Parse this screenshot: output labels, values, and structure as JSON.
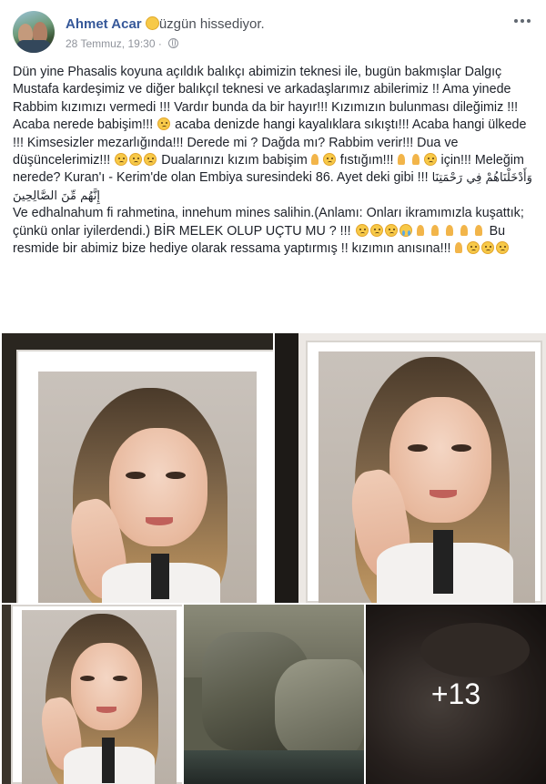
{
  "post": {
    "author": "Ahmet Acar",
    "feeling": "üzgün hissediyor.",
    "timestamp": "28 Temmuz, 19:30",
    "privacy_icon": "globe-icon",
    "more_icon": "more-horizontal-icon",
    "text": {
      "p1": "Dün yine Phasalis koyuna açıldık balıkçı abimizin teknesi ile, bugün bakmışlar Dalgıç Mustafa kardeşimiz ve diğer balıkçıl teknesi ve arkadaşlarımız abilerimiz !! Ama yinede Rabbim kızımızı vermedi !!! Vardır bunda da bir hayır!!! Kızımızın bulunması dileğimiz !!! Acaba nerede babişim!!!",
      "p1b": "acaba denizde hangi kayalıklara sıkıştı!!! Acaba hangi ülkede !!! Kimsesizler mezarlığında!!! Derede mi ? Dağda mı? Rabbim verir!!! Dua ve düşüncelerimiz!!!",
      "p1c": "Dualarınızı kızım babişim",
      "p1d": "fıstığım!!!",
      "p1e": "için!!! Meleğim nerede? Kuran'ı - Kerim'de olan Embiya suresindeki 86. Ayet deki gibi !!!",
      "arabic": "وَأَدْخَلْنَاهُمْ فِي رَحْمَتِنَا إِنَّهُم مِّنَ الصَّالِحِينَ",
      "p2": "Ve edhalnahum fi rahmetina, innehum mines salihin.(Anlamı: Onları ikramımızla kuşattık; çünkü onlar iyilerdendi.) BİR MELEK OLUP UÇTU MU ? !!!",
      "p3": "Bu resmide bir abimiz bize hediye olarak ressama yaptırmış !! kızımın anısına!!!"
    },
    "photos": {
      "more_count": "+13"
    }
  }
}
